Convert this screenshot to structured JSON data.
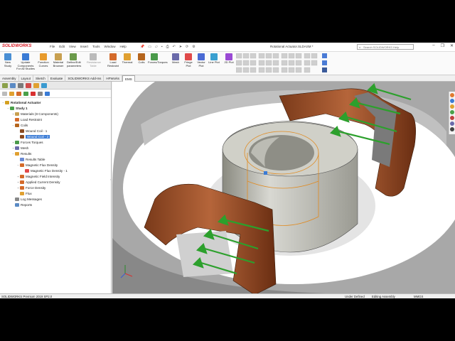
{
  "app": {
    "logo": "SOLIDWORKS",
    "document_title": "Rotational Actuator.SLDASM *",
    "search_placeholder": "Search SOLIDWORKS Help"
  },
  "menu": [
    "File",
    "Edit",
    "View",
    "Insert",
    "Tools",
    "Window",
    "Help"
  ],
  "ribbon": [
    {
      "label": "New Study",
      "color": "#4a8fd4"
    },
    {
      "label": "Update Components For All Studies",
      "color": "#3a7bd5"
    },
    {
      "label": "Function Curves",
      "color": "#e89b2c"
    },
    {
      "label": "Material Browser",
      "color": "#c8a050"
    },
    {
      "label": "Define/Edit parameters",
      "color": "#6a9a4a"
    },
    {
      "label": "Resistance Table",
      "color": "#bbbbbb",
      "dim": true
    },
    {
      "label": "Load Restraint",
      "color": "#d46a2a"
    },
    {
      "label": "Thermal",
      "color": "#e0a030"
    },
    {
      "label": "Coils",
      "color": "#b5651d"
    },
    {
      "label": "Forces/Torques",
      "color": "#4a9a4a"
    },
    {
      "label": "Mesh",
      "color": "#6a6aaa"
    },
    {
      "label": "Fringe Plot",
      "color": "#e04a4a"
    },
    {
      "label": "Vector Plot",
      "color": "#4a6ad4"
    },
    {
      "label": "Line Plot",
      "color": "#3aa0d0"
    },
    {
      "label": "2D Plot",
      "color": "#9a4ad4"
    }
  ],
  "tabs": [
    "Assembly",
    "Layout",
    "Sketch",
    "Evaluate",
    "SOLIDWORKS Add-Ins",
    "HFWorks",
    "EMS"
  ],
  "active_tab": "EMS",
  "tree": [
    {
      "label": "Rotational Actuator",
      "level": 0,
      "bold": true,
      "expander": "−",
      "color": "#d4a020"
    },
    {
      "label": "Study 1",
      "level": 1,
      "bold": true,
      "expander": "−",
      "color": "#4aa04a"
    },
    {
      "label": "Materials    (8 Components)",
      "level": 2,
      "expander": "+",
      "color": "#c8a050"
    },
    {
      "label": "Load Restraint",
      "level": 2,
      "expander": "",
      "color": "#d46a2a"
    },
    {
      "label": "Coils",
      "level": 2,
      "expander": "−",
      "color": "#b5651d"
    },
    {
      "label": "Wound Coil - 1",
      "level": 3,
      "expander": "",
      "color": "#8a4a20"
    },
    {
      "label": "Wound Coil - 2",
      "level": 3,
      "expander": "",
      "color": "#8a4a20",
      "selected": true
    },
    {
      "label": "Forces Torques",
      "level": 2,
      "expander": "+",
      "color": "#4a9a4a"
    },
    {
      "label": "Mesh",
      "level": 2,
      "expander": "+",
      "color": "#6a6aaa"
    },
    {
      "label": "Results",
      "level": 2,
      "expander": "−",
      "color": "#e0a030"
    },
    {
      "label": "Results Table",
      "level": 3,
      "expander": "",
      "color": "#6a8ad4"
    },
    {
      "label": "Magnetic Flux Density",
      "level": 3,
      "expander": "−",
      "color": "#d46a2a"
    },
    {
      "label": "Magnetic Flux Density - 1",
      "level": 4,
      "expander": "",
      "color": "#e04a4a"
    },
    {
      "label": "Magnetic Field Intensity",
      "level": 3,
      "expander": "+",
      "color": "#d46a2a"
    },
    {
      "label": "Applied Current Density",
      "level": 3,
      "expander": "+",
      "color": "#d46a2a"
    },
    {
      "label": "Force Density",
      "level": 3,
      "expander": "+",
      "color": "#d46a2a"
    },
    {
      "label": "Flux",
      "level": 3,
      "expander": "",
      "color": "#e0a030"
    },
    {
      "label": "Log Messages",
      "level": 2,
      "expander": "",
      "color": "#888888"
    },
    {
      "label": "Reports",
      "level": 2,
      "expander": "",
      "color": "#5a8ac4"
    }
  ],
  "status": {
    "version": "SOLIDWORKS Premium 2019 SP2.0",
    "definition": "Under Defined",
    "mode": "Editing Assembly",
    "units": "MMGS"
  }
}
